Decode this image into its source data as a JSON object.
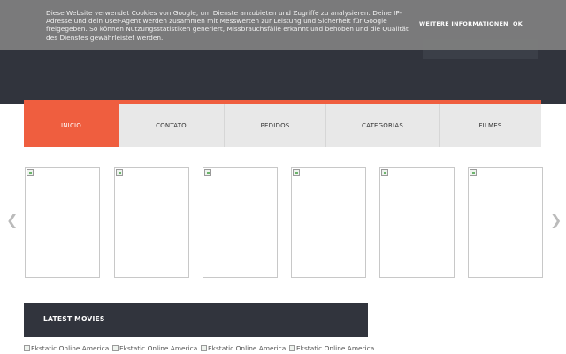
{
  "cookie_bar": {
    "text": "Diese Website verwendet Cookies von Google, um Dienste anzubieten und Zugriffe zu analysieren. Deine IP-Adresse und dein User-Agent werden zusammen mit Messwerten zur Leistung und Sicherheit für Google freigegeben. So können Nutzungsstatistiken generiert, Missbrauchsfälle erkannt und behoben und die Qualität des Dienstes gewährleistet werden.",
    "more_label": "WEITERE INFORMATIONEN",
    "ok_label": "OK"
  },
  "nav": {
    "items": [
      {
        "label": "INICIO",
        "active": true
      },
      {
        "label": "CONTATO",
        "active": false
      },
      {
        "label": "PEDIDOS",
        "active": false
      },
      {
        "label": "CATEGORIAS",
        "active": false
      },
      {
        "label": "FILMES",
        "active": false
      }
    ]
  },
  "slider": {
    "slide_count": 6,
    "prev_icon": "chevron-left-icon",
    "next_icon": "chevron-right-icon"
  },
  "latest": {
    "title": "LATEST MOVIES",
    "thumbnails": [
      {
        "alt": "Ekstatic Online American"
      },
      {
        "alt": "Ekstatic Online American"
      },
      {
        "alt": "Ekstatic Online American"
      },
      {
        "alt": "Ekstatic Online American"
      }
    ]
  },
  "colors": {
    "accent": "#ef5e3f",
    "dark": "#31343d",
    "nav_bg": "#e8e8e8",
    "cookie_bg": "#808080"
  }
}
